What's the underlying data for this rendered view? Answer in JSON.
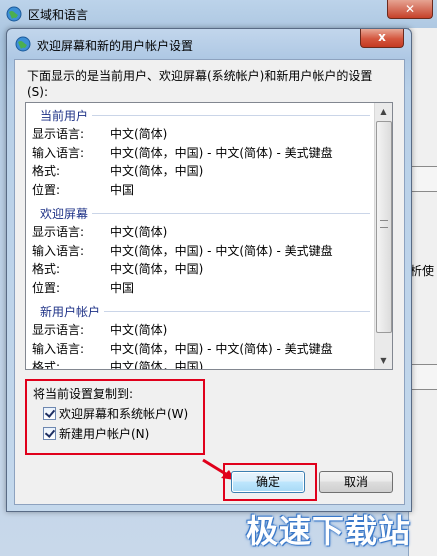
{
  "background_window": {
    "title": "区域和语言",
    "side_text": "析使"
  },
  "dialog": {
    "title": "欢迎屏幕和新的用户帐户设置",
    "close_label": "x",
    "description": "下面显示的是当前用户、欢迎屏幕(系统帐户)和新用户帐户的设置(S):"
  },
  "sections": [
    {
      "header": "当前用户",
      "rows": [
        {
          "label": "显示语言:",
          "value": "中文(简体)"
        },
        {
          "label": "输入语言:",
          "value": "中文(简体，中国) - 中文(简体) - 美式键盘"
        },
        {
          "label": "格式:",
          "value": "中文(简体，中国)"
        },
        {
          "label": "位置:",
          "value": "中国"
        }
      ]
    },
    {
      "header": "欢迎屏幕",
      "rows": [
        {
          "label": "显示语言:",
          "value": "中文(简体)"
        },
        {
          "label": "输入语言:",
          "value": "中文(简体，中国) - 中文(简体) - 美式键盘"
        },
        {
          "label": "格式:",
          "value": "中文(简体，中国)"
        },
        {
          "label": "位置:",
          "value": "中国"
        }
      ]
    },
    {
      "header": "新用户帐户",
      "rows": [
        {
          "label": "显示语言:",
          "value": "中文(简体)"
        },
        {
          "label": "输入语言:",
          "value": "中文(简体，中国) - 中文(简体) - 美式键盘"
        },
        {
          "label": "格式:",
          "value": "中文(简体，中国)"
        },
        {
          "label": "位置:",
          "value": "中国"
        }
      ]
    }
  ],
  "copy_settings": {
    "title": "将当前设置复制到:",
    "options": [
      {
        "label": "欢迎屏幕和系统帐户(W)",
        "checked": true
      },
      {
        "label": "新建用户帐户(N)",
        "checked": true
      }
    ]
  },
  "buttons": {
    "ok": "确定",
    "cancel": "取消"
  },
  "watermark": "极速下载站",
  "colors": {
    "highlight": "#e0001b",
    "section_header": "#1e3287"
  }
}
